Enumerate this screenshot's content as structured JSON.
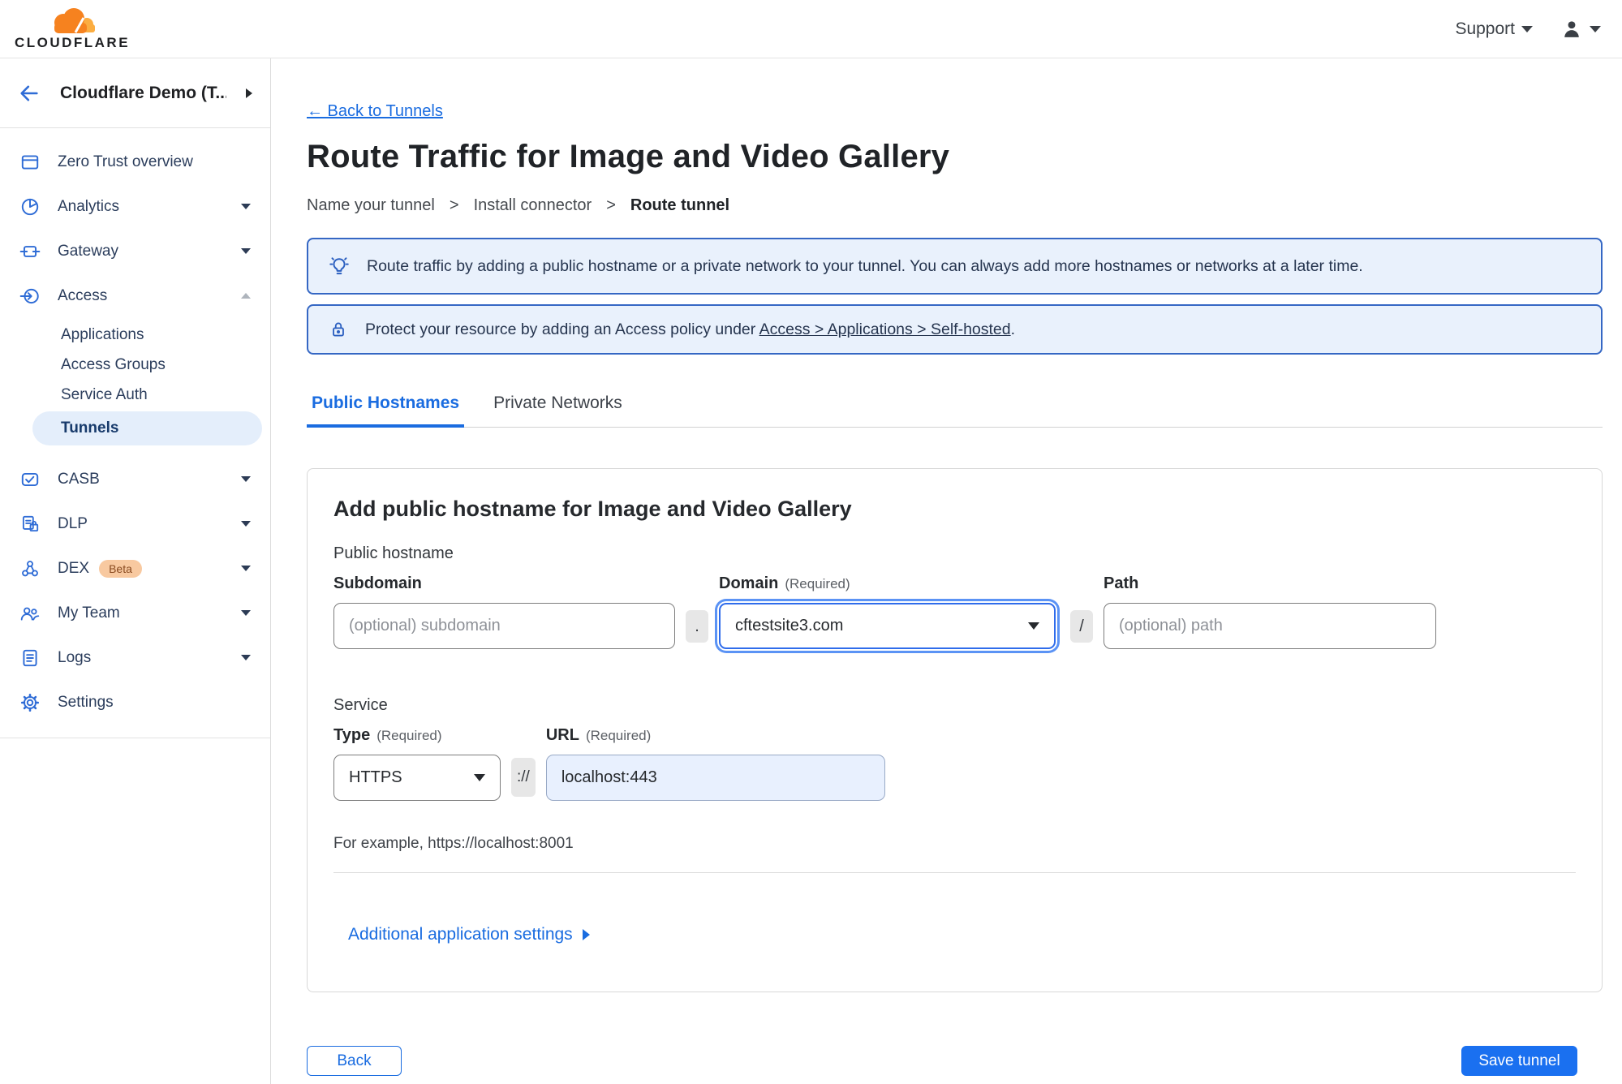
{
  "colors": {
    "accent_blue": "#1a6ce0",
    "save_button_blue": "#1a70f0",
    "brand_orange": "#f6821f",
    "brand_orange_light": "#fbad41",
    "banner_bg": "#e9f1fc",
    "banner_border": "#3567c4",
    "active_pill_bg": "#e4eefb",
    "beta_badge_bg": "#f8c9a0",
    "url_field_bg": "#e8f0fe",
    "sidebar_icon_blue": "#2f6cd6"
  },
  "topbar": {
    "brand": "CLOUDFLARE",
    "support_label": "Support"
  },
  "sidebar": {
    "account_label": "Cloudflare Demo (T...",
    "items": [
      {
        "label": "Zero Trust overview",
        "icon": "overview-icon",
        "caret": "none"
      },
      {
        "label": "Analytics",
        "icon": "analytics-icon",
        "caret": "down"
      },
      {
        "label": "Gateway",
        "icon": "gateway-icon",
        "caret": "down"
      },
      {
        "label": "Access",
        "icon": "access-icon",
        "caret": "up",
        "children": [
          {
            "label": "Applications"
          },
          {
            "label": "Access Groups"
          },
          {
            "label": "Service Auth"
          },
          {
            "label": "Tunnels",
            "active": true
          }
        ]
      },
      {
        "label": "CASB",
        "icon": "casb-icon",
        "caret": "down"
      },
      {
        "label": "DLP",
        "icon": "dlp-icon",
        "caret": "down"
      },
      {
        "label": "DEX",
        "icon": "dex-icon",
        "caret": "down",
        "badge": "Beta"
      },
      {
        "label": "My Team",
        "icon": "team-icon",
        "caret": "down"
      },
      {
        "label": "Logs",
        "icon": "logs-icon",
        "caret": "down"
      },
      {
        "label": "Settings",
        "icon": "settings-icon",
        "caret": "none"
      }
    ]
  },
  "page": {
    "back_link": "← Back to Tunnels",
    "title": "Route Traffic for Image and Video Gallery",
    "breadcrumb": [
      "Name your tunnel",
      "Install connector",
      "Route tunnel"
    ],
    "breadcrumb_separator": ">"
  },
  "banners": {
    "info": {
      "icon": "lightbulb-icon",
      "text": "Route traffic by adding a public hostname or a private network to your tunnel. You can always add more hostnames or networks at a later time."
    },
    "access": {
      "icon": "lock-icon",
      "prefix": "Protect your resource by adding an Access policy under ",
      "link": "Access > Applications > Self-hosted",
      "suffix": "."
    }
  },
  "tabs": [
    {
      "label": "Public Hostnames"
    },
    {
      "label": "Private Networks"
    }
  ],
  "form": {
    "card_title": "Add public hostname for Image and Video Gallery",
    "public_hostname_heading": "Public hostname",
    "subdomain": {
      "label": "Subdomain",
      "placeholder": "(optional) subdomain"
    },
    "dot_separator": ".",
    "domain": {
      "label": "Domain",
      "required_hint": "(Required)",
      "value": "cftestsite3.com"
    },
    "slash_separator": "/",
    "path": {
      "label": "Path",
      "placeholder": "(optional) path"
    },
    "service_heading": "Service",
    "type": {
      "label": "Type",
      "required_hint": "(Required)",
      "value": "HTTPS"
    },
    "scheme_separator": "://",
    "url": {
      "label": "URL",
      "required_hint": "(Required)",
      "value": "localhost:443"
    },
    "example_text": "For example, https://localhost:8001",
    "additional_settings_label": "Additional application settings"
  },
  "footer": {
    "back_label": "Back",
    "save_label": "Save tunnel"
  }
}
